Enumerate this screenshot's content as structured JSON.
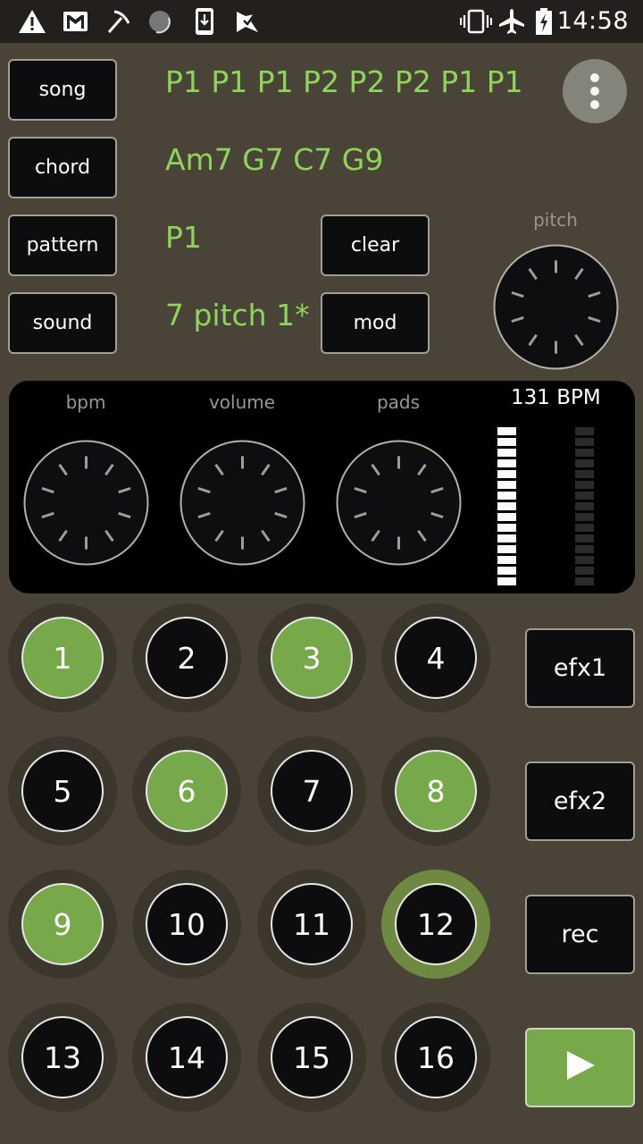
{
  "status_bar": {
    "left_icons": [
      "warning-icon",
      "gmail-icon",
      "pickaxe-icon",
      "sync-progress-icon",
      "download-phone-icon",
      "check-flag-icon"
    ],
    "right_icons": [
      "vibrate-icon",
      "airplane-mode-icon",
      "battery-charging-icon"
    ],
    "time": "14:58"
  },
  "colors": {
    "background": "#4a4438",
    "accent_green": "#77a84a",
    "info_text": "#8fd45a",
    "button_bg": "#0d0c0f"
  },
  "top": {
    "song_button": "song",
    "song_value": "P1 P1 P1 P2 P2 P2 P1 P1",
    "chord_button": "chord",
    "chord_value": "Am7 G7 C7 G9",
    "pattern_button": "pattern",
    "pattern_value": "P1",
    "sound_button": "sound",
    "sound_value": "7 pitch 1*",
    "clear_button": "clear",
    "mod_button": "mod",
    "more_icon": "more-vert-icon",
    "pitch_label": "pitch"
  },
  "panel": {
    "knobs": [
      {
        "label": "bpm"
      },
      {
        "label": "volume"
      },
      {
        "label": "pads"
      }
    ],
    "bpm_readout": "131 BPM",
    "meters": {
      "segments": 15,
      "left_level": 1.0,
      "right_level": 0.0
    }
  },
  "pads": [
    {
      "label": "1",
      "on": true,
      "selected": false
    },
    {
      "label": "2",
      "on": false,
      "selected": false
    },
    {
      "label": "3",
      "on": true,
      "selected": false
    },
    {
      "label": "4",
      "on": false,
      "selected": false
    },
    {
      "label": "5",
      "on": false,
      "selected": false
    },
    {
      "label": "6",
      "on": true,
      "selected": false
    },
    {
      "label": "7",
      "on": false,
      "selected": false
    },
    {
      "label": "8",
      "on": true,
      "selected": false
    },
    {
      "label": "9",
      "on": true,
      "selected": false
    },
    {
      "label": "10",
      "on": false,
      "selected": false
    },
    {
      "label": "11",
      "on": false,
      "selected": false
    },
    {
      "label": "12",
      "on": false,
      "selected": true
    },
    {
      "label": "13",
      "on": false,
      "selected": false
    },
    {
      "label": "14",
      "on": false,
      "selected": false
    },
    {
      "label": "15",
      "on": false,
      "selected": false
    },
    {
      "label": "16",
      "on": false,
      "selected": false
    }
  ],
  "side_buttons": {
    "efx1": "efx1",
    "efx2": "efx2",
    "rec": "rec",
    "play_icon": "play-icon"
  }
}
